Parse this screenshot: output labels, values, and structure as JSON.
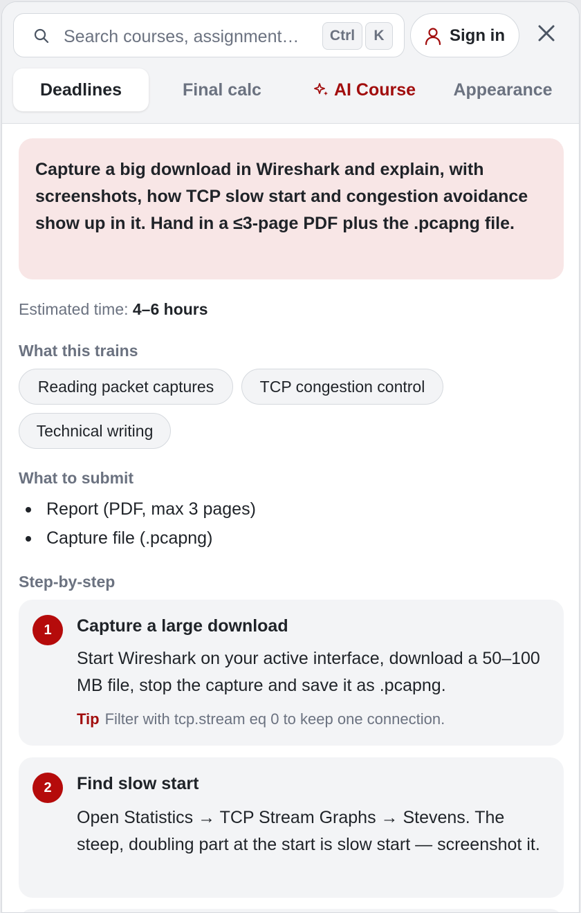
{
  "header": {
    "search_placeholder": "Search courses, assignment…",
    "kbd_ctrl": "Ctrl",
    "kbd_k": "K",
    "signin_label": "Sign in"
  },
  "tabs": [
    {
      "label": "Deadlines"
    },
    {
      "label": "Final calc"
    },
    {
      "label": "AI Course"
    },
    {
      "label": "Appearance"
    }
  ],
  "assignment": {
    "prompt": "Capture a big download in Wireshark and explain, with screenshots, how TCP slow start and congestion avoidance show up in it. Hand in a ≤3-page PDF plus the .pcapng file.",
    "estimated_label": "Estimated time:",
    "estimated_value": "4–6 hours",
    "trains_heading": "What this trains",
    "trains": [
      "Reading packet captures",
      "TCP congestion control",
      "Technical writing"
    ],
    "submit_heading": "What to submit",
    "submit": [
      "Report (PDF, max 3 pages)",
      "Capture file (.pcapng)"
    ],
    "steps_heading": "Step-by-step",
    "steps": [
      {
        "num": "1",
        "title": "Capture a large download",
        "desc": "Start Wireshark on your active interface, download a 50–100 MB file, stop the capture and save it as .pcapng.",
        "tip_label": "Tip",
        "tip": "Filter with tcp.stream eq 0 to keep one connection."
      },
      {
        "num": "2",
        "title": "Find slow start",
        "desc": "Open Statistics → TCP Stream Graphs → Stevens. The steep, doubling part at the start is slow start — screenshot it."
      }
    ]
  },
  "colors": {
    "accent": "#a10d0d",
    "badge": "#b50b0b",
    "prompt_bg": "#f8e6e6"
  }
}
